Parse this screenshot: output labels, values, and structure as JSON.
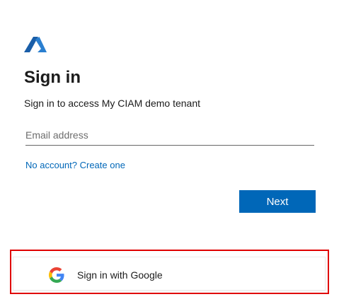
{
  "brand": {
    "logo_icon": "azure-logo-icon",
    "accent_color": "#0067b8"
  },
  "signin": {
    "title": "Sign in",
    "subtitle": "Sign in to access My CIAM demo tenant",
    "email_placeholder": "Email address",
    "email_value": "",
    "create_account_link": "No account? Create one",
    "next_label": "Next"
  },
  "social": {
    "google_label": "Sign in with Google",
    "google_icon": "google-icon",
    "highlight_color": "#e00000"
  }
}
